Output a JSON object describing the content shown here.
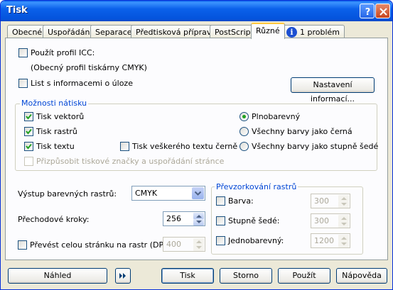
{
  "window": {
    "title": "Tisk"
  },
  "tabs": [
    {
      "label": "Obecné"
    },
    {
      "label": "Uspořádání"
    },
    {
      "label": "Separace"
    },
    {
      "label": "Předtisková příprava"
    },
    {
      "label": "PostScript"
    },
    {
      "label": "Různé"
    },
    {
      "label": "1 problém"
    }
  ],
  "icc": {
    "use_profile_label": "Použít profil ICC:",
    "profile_name": "(Obecný profil tiskárny CMYK)",
    "job_info_label": "List s informacemi o úloze",
    "settings_button": "Nastavení informací..."
  },
  "proof": {
    "group_title": "Možnosti nátisku",
    "print_vectors": "Tisk vektorů",
    "print_rasters": "Tisk rastrů",
    "print_text": "Tisk textu",
    "print_all_text_black": "Tisk veškerého textu černě",
    "adjust_marks": "Přizpůsobit tiskové značky a uspořádání stránce",
    "full_color": "Plnobarevný",
    "all_black": "Všechny barvy jako černá",
    "all_gray": "Všechny barvy jako stupně šedé"
  },
  "output": {
    "raster_output_label": "Výstup barevných rastrů:",
    "raster_output_value": "CMYK",
    "gradient_steps_label": "Přechodové kroky:",
    "gradient_steps_value": "256",
    "rasterize_page_label": "Převést celou stránku na rastr (DPI):",
    "rasterize_page_value": "400"
  },
  "resample": {
    "group_title": "Převzorkování rastrů",
    "color_label": "Barva:",
    "color_value": "300",
    "grayscale_label": "Stupně šedé:",
    "grayscale_value": "300",
    "mono_label": "Jednobarevný:",
    "mono_value": "1200"
  },
  "buttons": {
    "preview": "Náhled",
    "print": "Tisk",
    "cancel": "Storno",
    "apply": "Použít",
    "help": "Nápověda"
  },
  "icons": {
    "info": "info-icon",
    "forward": "double-arrow-icon"
  }
}
